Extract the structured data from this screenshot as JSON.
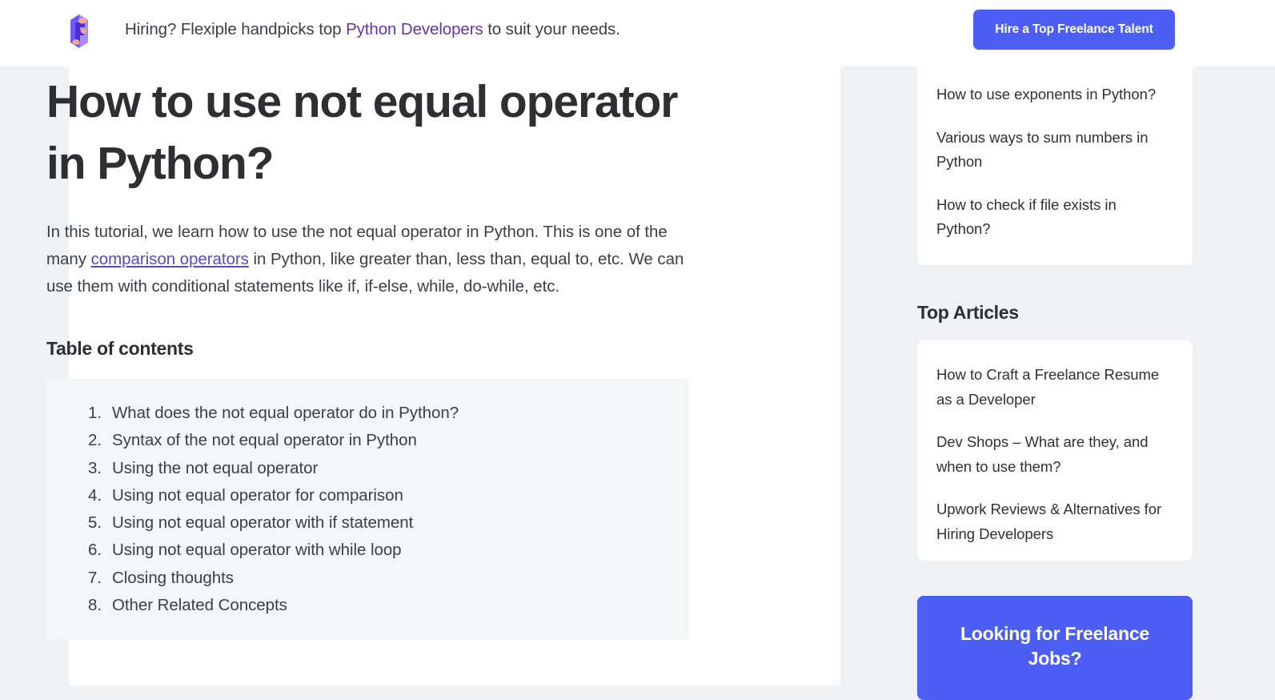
{
  "header": {
    "logo_icon": "flexiple-f-logo",
    "tagline_before": "Hiring? Flexiple handpicks top ",
    "tagline_link": "Python Developers",
    "tagline_after": " to suit your needs.",
    "cta_button": "Hire a Top Freelance Talent",
    "cta_color": "#4d5ef5"
  },
  "article": {
    "title": "How to use not equal operator in Python?",
    "intro_part1": "In this tutorial, we learn how to use the not equal operator in Python. This is one of the many ",
    "intro_link": "comparison operators",
    "intro_part2": " in Python, like greater than, less than, equal to, etc. We can use them with conditional statements like if, if-else, while, do-while, etc.",
    "link_color": "#5b46c4",
    "toc_heading": "Table of contents",
    "toc_items": [
      "What does the not equal operator do in Python?",
      "Syntax of the not equal operator in Python",
      "Using the not equal operator",
      "Using not equal operator for comparison",
      "Using not equal operator with if statement",
      "Using not equal operator with while loop",
      "Closing thoughts",
      "Other Related Concepts"
    ]
  },
  "sidebar": {
    "related_links": [
      "How to use exponents in Python?",
      "Various ways to sum numbers in Python",
      "How to check if file exists in Python?"
    ],
    "top_articles_heading": "Top Articles",
    "top_articles": [
      "How to Craft a Freelance Resume as a Developer",
      "Dev Shops – What are they, and when to use them?",
      "Upwork Reviews & Alternatives for Hiring Developers"
    ],
    "cta_title": "Looking for Freelance Jobs?",
    "cta_color": "#4d5ef5"
  }
}
